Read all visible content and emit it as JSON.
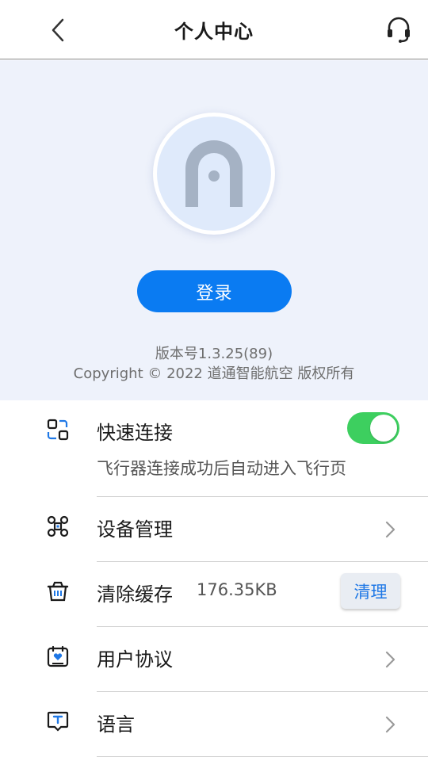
{
  "header": {
    "title": "个人中心",
    "back_icon": "chevron-left-icon",
    "support_icon": "headset-icon"
  },
  "profile": {
    "avatar_icon": "avatar-placeholder-icon",
    "login_label": "登录",
    "version": "版本号1.3.25(89)",
    "copyright": "Copyright © 2022 道通智能航空 版权所有"
  },
  "settings": {
    "quick_connect": {
      "label": "快速连接",
      "description": "飞行器连接成功后自动进入飞行页",
      "enabled": true,
      "icon": "quick-connect-icon"
    },
    "device_management": {
      "label": "设备管理",
      "icon": "drone-icon"
    },
    "clear_cache": {
      "label": "清除缓存",
      "size": "176.35KB",
      "button_label": "清理",
      "icon": "trash-basket-icon"
    },
    "user_agreement": {
      "label": "用户协议",
      "icon": "agreement-icon"
    },
    "language": {
      "label": "语言",
      "icon": "language-icon"
    }
  },
  "colors": {
    "accent": "#0a7bf2",
    "toggle_on": "#3dcf5f",
    "profile_bg": "#eef2fb"
  }
}
